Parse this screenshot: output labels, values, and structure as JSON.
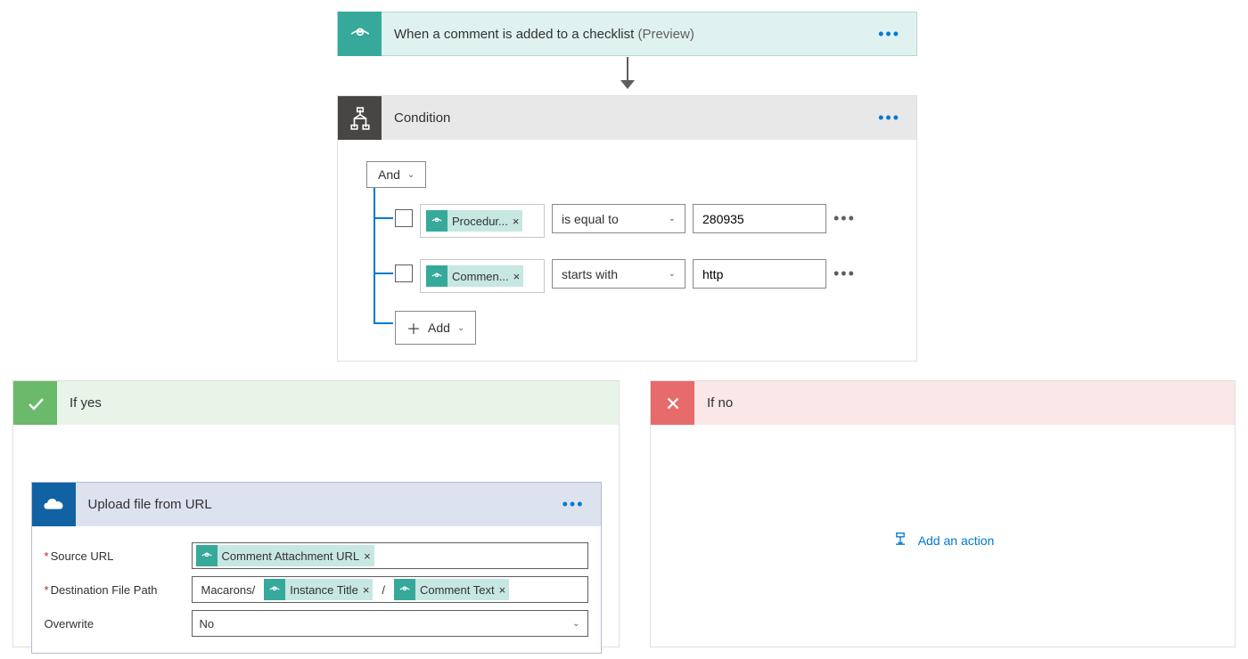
{
  "trigger": {
    "title": "When a comment is added to a checklist",
    "preview": "(Preview)"
  },
  "condition": {
    "title": "Condition",
    "operator": "And",
    "add_label": "Add",
    "rows": [
      {
        "token": "Procedur...",
        "op": "is equal to",
        "value": "280935"
      },
      {
        "token": "Commen...",
        "op": "starts with",
        "value": "http"
      }
    ]
  },
  "branches": {
    "yes_label": "If yes",
    "no_label": "If no",
    "add_action": "Add an action"
  },
  "action": {
    "title": "Upload file from URL",
    "fields": {
      "source_url": {
        "label": "Source URL",
        "token": "Comment Attachment URL"
      },
      "dest_path": {
        "label": "Destination File Path",
        "prefix": "Macarons/",
        "token1": "Instance Title",
        "sep": "/",
        "token2": "Comment Text"
      },
      "overwrite": {
        "label": "Overwrite",
        "value": "No"
      }
    }
  }
}
